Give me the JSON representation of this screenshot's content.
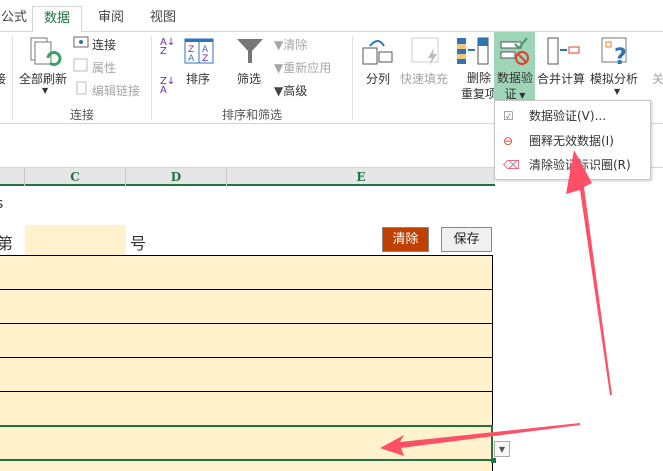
{
  "tabs": [
    {
      "label": "公式"
    },
    {
      "label": "数据",
      "active": true
    },
    {
      "label": "审阅"
    },
    {
      "label": "视图"
    }
  ],
  "ribbon": {
    "left_partial": "接",
    "connections": {
      "refresh_all": "全部刷新",
      "connect": "连接",
      "properties": "属性",
      "edit_links": "编辑链接",
      "group": "连接"
    },
    "sort_filter": {
      "sort": "排序",
      "filter": "筛选",
      "clear": "清除",
      "reapply": "重新应用",
      "advanced": "高级",
      "group": "排序和筛选"
    },
    "tools": {
      "text_to_columns": "分列",
      "flash_fill": "快速填充",
      "remove_dup_1": "删除",
      "remove_dup_2": "重复项",
      "validation_1": "数据验",
      "validation_2": "证",
      "consolidate": "合并计算",
      "what_if": "模拟分析",
      "relations_partial": "关"
    }
  },
  "menu": {
    "items": [
      {
        "label": "数据验证(V)..."
      },
      {
        "label": "圈释无效数据(I)"
      },
      {
        "label": "清除验证标识圈(R)"
      }
    ]
  },
  "columns": [
    "C",
    "D",
    "E"
  ],
  "sheet": {
    "row1_partial": "s",
    "di": "第",
    "hao": "号",
    "clear_button": "清除",
    "save_button": "保存"
  },
  "colors": {
    "accent": "#217346",
    "cell_fill": "#fff2cc",
    "clear_btn": "#c04000",
    "arrow": "#ff5068",
    "highlight": "#9fd5b7"
  }
}
